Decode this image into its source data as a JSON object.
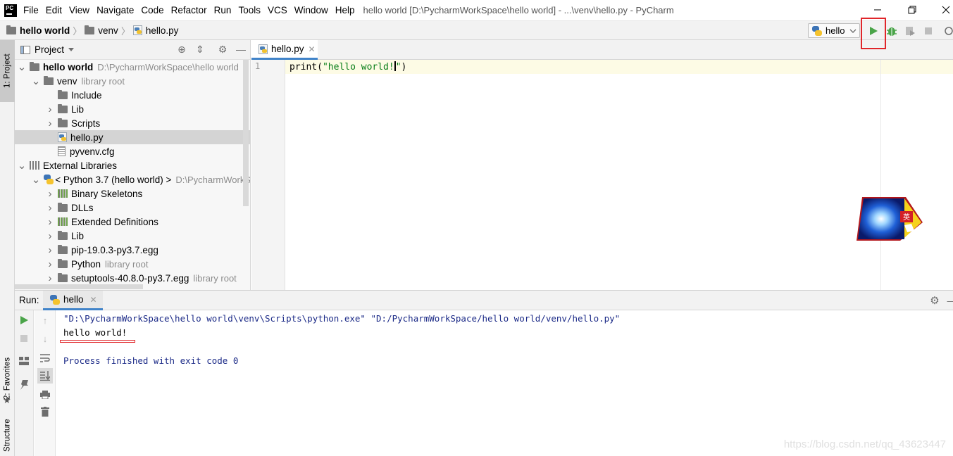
{
  "app": {
    "logo_text": "PC",
    "window_title": "hello world [D:\\PycharmWorkSpace\\hello world] - ...\\venv\\hello.py - PyCharm",
    "menu": [
      "File",
      "Edit",
      "View",
      "Navigate",
      "Code",
      "Refactor",
      "Run",
      "Tools",
      "VCS",
      "Window",
      "Help"
    ]
  },
  "navbar": {
    "breadcrumbs": [
      "hello world",
      "venv",
      "hello.py"
    ],
    "run_config": "hello"
  },
  "left_strip": {
    "project_tab": "1: Project",
    "favorites_tab": "2: Favorites",
    "structure_tab": "Structure"
  },
  "project_panel": {
    "title": "Project",
    "tree": [
      {
        "label": "hello world",
        "hint": "D:\\PycharmWorkSpace\\hello world",
        "arrow": "▼",
        "indent": 0,
        "icon": "folder",
        "bold": true
      },
      {
        "label": "venv",
        "hint": "library root",
        "arrow": "▼",
        "indent": 1,
        "icon": "folder"
      },
      {
        "label": "Include",
        "hint": "",
        "arrow": "",
        "indent": 2,
        "icon": "folder"
      },
      {
        "label": "Lib",
        "hint": "",
        "arrow": "▶",
        "indent": 2,
        "icon": "folder"
      },
      {
        "label": "Scripts",
        "hint": "",
        "arrow": "▶",
        "indent": 2,
        "icon": "folder"
      },
      {
        "label": "hello.py",
        "hint": "",
        "arrow": "",
        "indent": 2,
        "icon": "python-file",
        "selected": true
      },
      {
        "label": "pyvenv.cfg",
        "hint": "",
        "arrow": "",
        "indent": 2,
        "icon": "text-file"
      },
      {
        "label": "External Libraries",
        "hint": "",
        "arrow": "▼",
        "indent": 0,
        "icon": "library"
      },
      {
        "label": "< Python 3.7 (hello world) >",
        "hint": "D:\\PycharmWorkS",
        "arrow": "▼",
        "indent": 1,
        "icon": "python-logo"
      },
      {
        "label": "Binary Skeletons",
        "hint": "",
        "arrow": "▶",
        "indent": 2,
        "icon": "library-green"
      },
      {
        "label": "DLLs",
        "hint": "",
        "arrow": "▶",
        "indent": 2,
        "icon": "folder"
      },
      {
        "label": "Extended Definitions",
        "hint": "",
        "arrow": "▶",
        "indent": 2,
        "icon": "library-green"
      },
      {
        "label": "Lib",
        "hint": "",
        "arrow": "▶",
        "indent": 2,
        "icon": "folder"
      },
      {
        "label": "pip-19.0.3-py3.7.egg",
        "hint": "",
        "arrow": "▶",
        "indent": 2,
        "icon": "folder"
      },
      {
        "label": "Python",
        "hint": "library root",
        "arrow": "▶",
        "indent": 2,
        "icon": "folder"
      },
      {
        "label": "setuptools-40.8.0-py3.7.egg",
        "hint": "library root",
        "arrow": "▶",
        "indent": 2,
        "icon": "folder"
      }
    ]
  },
  "editor": {
    "tab_label": "hello.py",
    "line_number": "1",
    "code_func": "print(",
    "code_string_before_caret": "\"hello world!",
    "code_string_after_caret": "\"",
    "code_end": ")"
  },
  "run_panel": {
    "label": "Run:",
    "tab_label": "hello",
    "console": {
      "command": "\"D:\\PycharmWorkSpace\\hello world\\venv\\Scripts\\python.exe\" \"D:/PycharmWorkSpace/hello world/venv/hello.py\"",
      "output": "hello world!",
      "exit": "Process finished with exit code 0"
    }
  },
  "watermark": "https://blog.csdn.net/qq_43623447",
  "colors": {
    "highlight_red": "#e0262a",
    "run_green": "#4aa449",
    "selection_gray": "#d4d4d4",
    "string_green": "#067d17",
    "console_blue": "#1b2a87"
  }
}
